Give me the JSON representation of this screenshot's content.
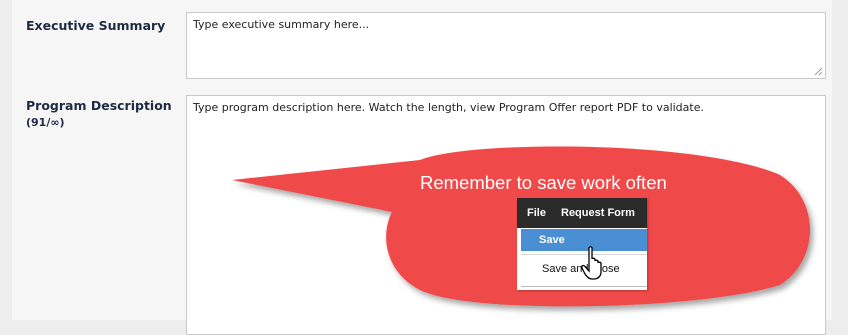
{
  "fields": {
    "executive_summary": {
      "label": "Executive Summary",
      "placeholder": "Type executive summary here..."
    },
    "program_description": {
      "label": "Program Description",
      "counter": "(91/∞)",
      "value": "Type program description here. Watch the length, view Program Offer report PDF to validate."
    }
  },
  "callout": {
    "text": "Remember to save work often",
    "color": "#f04a4a"
  },
  "menu": {
    "bar_items": [
      "File",
      "Request Form"
    ],
    "items": [
      "Save",
      "Save and Close"
    ],
    "highlight_color": "#4a8fd4"
  }
}
